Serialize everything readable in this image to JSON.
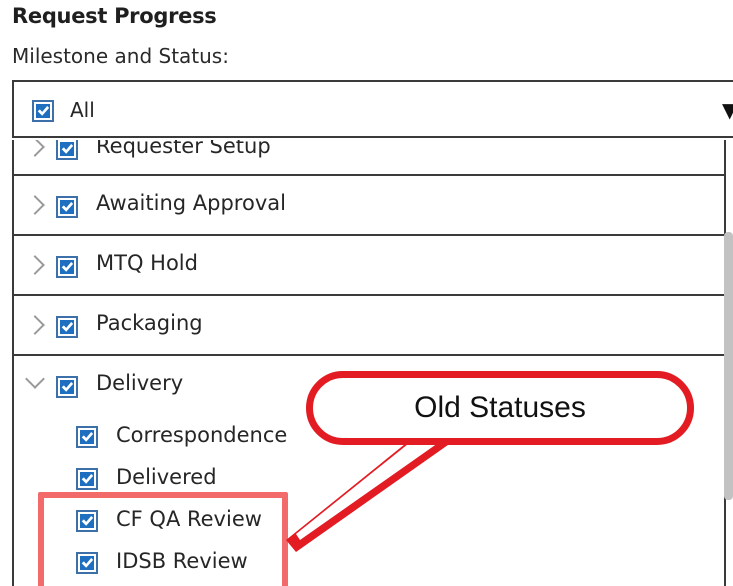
{
  "section": {
    "title": "Request Progress"
  },
  "field": {
    "label": "Milestone and Status:"
  },
  "select": {
    "value": "All",
    "checked": true,
    "caret_icon": "caret-down-icon"
  },
  "milestones": [
    {
      "label": "Requester Setup",
      "expanded": false,
      "checked": true
    },
    {
      "label": "Awaiting Approval",
      "expanded": false,
      "checked": true
    },
    {
      "label": "MTQ Hold",
      "expanded": false,
      "checked": true
    },
    {
      "label": "Packaging",
      "expanded": false,
      "checked": true
    },
    {
      "label": "Delivery",
      "expanded": true,
      "checked": true
    }
  ],
  "delivery_statuses": [
    {
      "label": "Correspondence",
      "checked": true
    },
    {
      "label": "Delivered",
      "checked": true
    },
    {
      "label": "CF QA Review",
      "checked": true
    },
    {
      "label": "IDSB Review",
      "checked": true
    }
  ],
  "annotation": {
    "text": "Old Statuses"
  },
  "colors": {
    "checkbox": "#1e6fbf",
    "callout_border": "#e31b23",
    "highlight_border": "#f26a6a"
  }
}
